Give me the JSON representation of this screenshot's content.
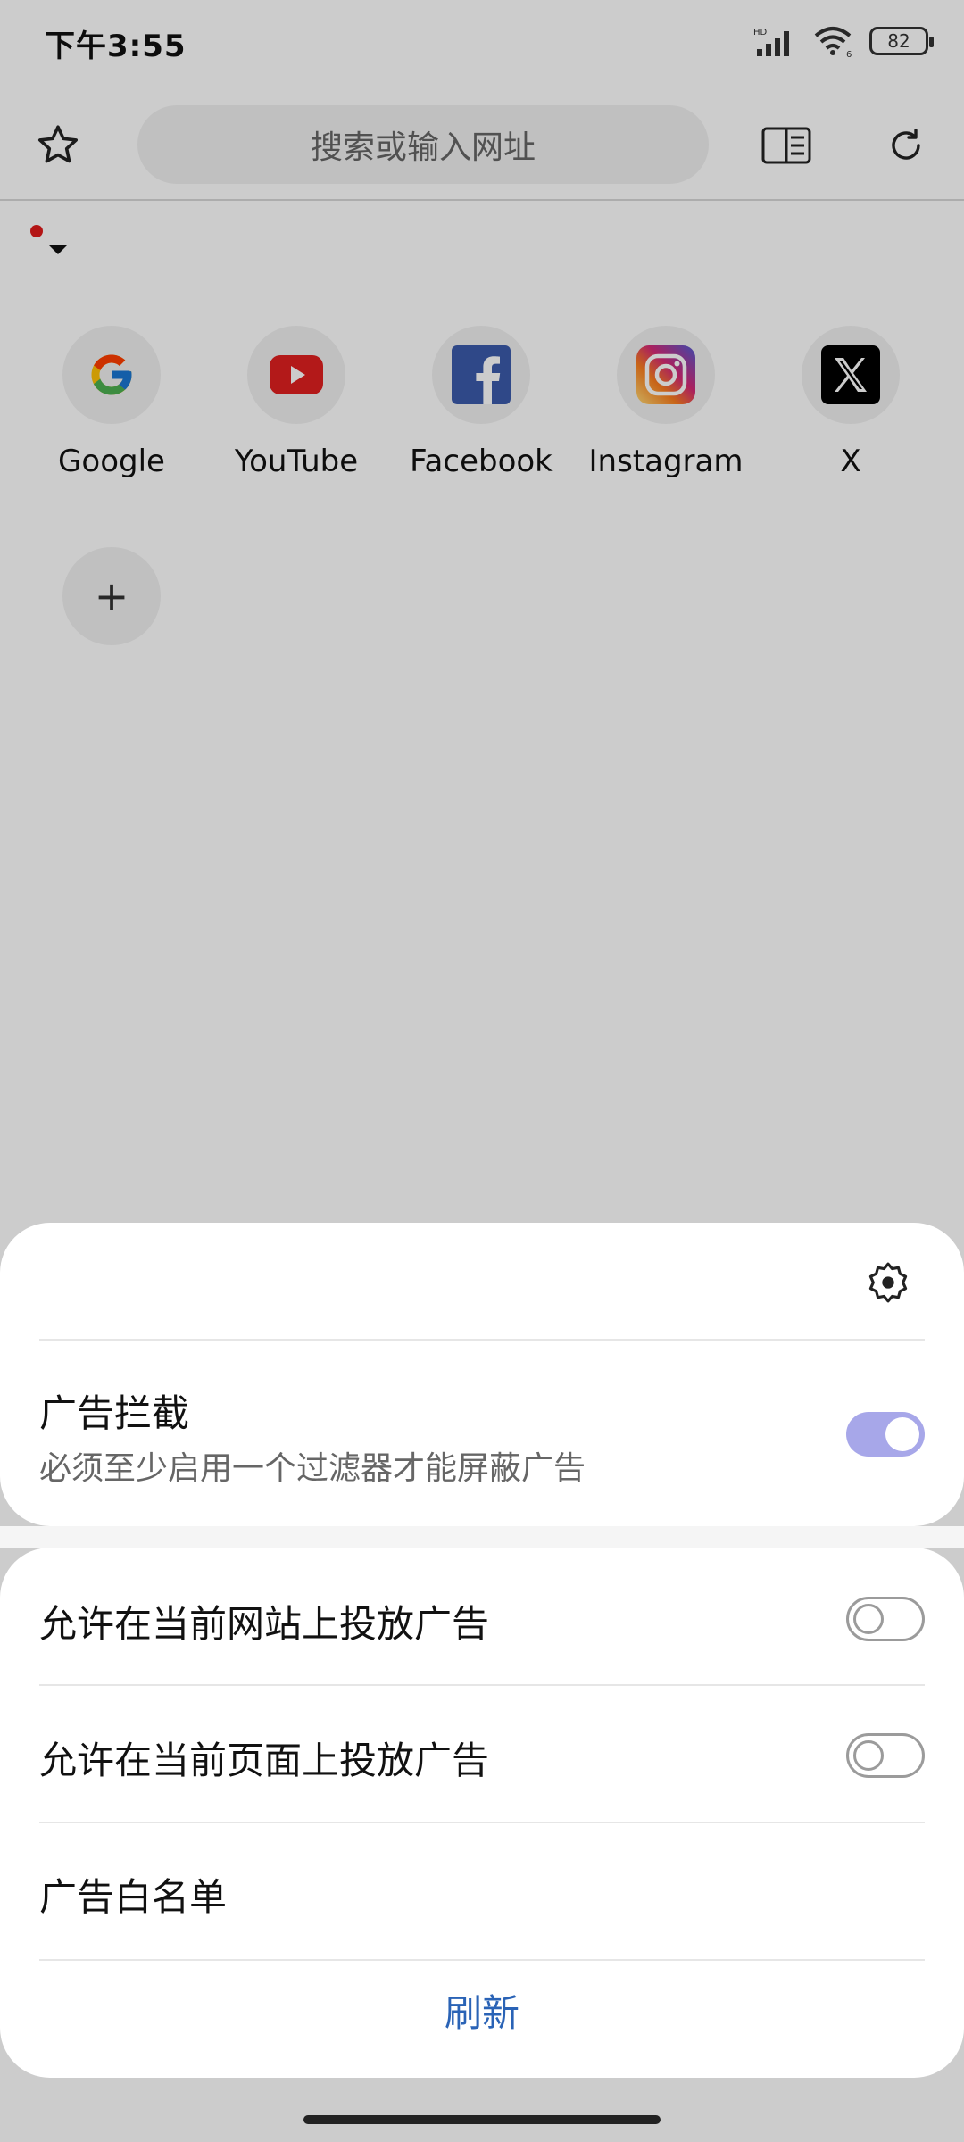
{
  "status_bar": {
    "time": "下午3:55",
    "battery": "82",
    "network": "HD",
    "wifi_badge": "6"
  },
  "toolbar": {
    "search_placeholder": "搜索或输入网址"
  },
  "shortcuts": [
    {
      "label": "Google",
      "icon": "google-icon"
    },
    {
      "label": "YouTube",
      "icon": "youtube-icon"
    },
    {
      "label": "Facebook",
      "icon": "facebook-icon"
    },
    {
      "label": "Instagram",
      "icon": "instagram-icon"
    },
    {
      "label": "X",
      "icon": "x-icon"
    }
  ],
  "add_shortcut": {
    "symbol": "+"
  },
  "sheet": {
    "ad_block_title": "广告拦截",
    "ad_block_subtitle": "必须至少启用一个过滤器才能屏蔽广告",
    "ad_block_enabled": true,
    "allow_site_label": "允许在当前网站上投放广告",
    "allow_site_enabled": false,
    "allow_page_label": "允许在当前页面上投放广告",
    "allow_page_enabled": false,
    "whitelist_label": "广告白名单",
    "refresh_label": "刷新"
  },
  "colors": {
    "accent_toggle": "#a7a7e9",
    "link_blue": "#2a63b6"
  }
}
